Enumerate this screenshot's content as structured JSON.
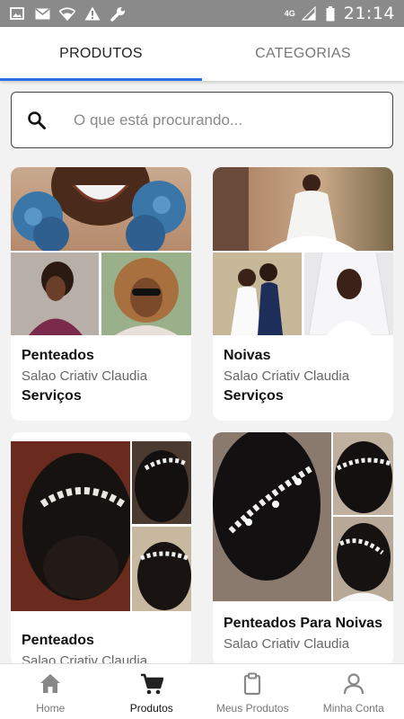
{
  "status_bar": {
    "time": "21:14",
    "network": "4G",
    "left_icons": [
      "image-icon",
      "mail-icon",
      "wifi-icon",
      "warning-icon",
      "wrench-icon"
    ],
    "right_icons": [
      "signal-icon",
      "battery-icon"
    ]
  },
  "tabs": [
    {
      "label": "PRODUTOS",
      "active": true
    },
    {
      "label": "CATEGORIAS",
      "active": false
    }
  ],
  "search": {
    "placeholder": "O que está procurando...",
    "value": ""
  },
  "products": [
    {
      "title": "Penteados",
      "seller": "Salao Criativ Claudia",
      "category": "Serviços"
    },
    {
      "title": "Noivas",
      "seller": "Salao Criativ Claudia",
      "category": "Serviços"
    },
    {
      "title": "Penteados",
      "seller": "Salao Criativ Claudia",
      "category": ""
    },
    {
      "title": "Penteados Para Noivas",
      "seller": "Salao Criativ Claudia",
      "category": ""
    }
  ],
  "bottom_nav": [
    {
      "label": "Home",
      "icon": "home-icon",
      "active": false
    },
    {
      "label": "Produtos",
      "icon": "cart-icon",
      "active": true
    },
    {
      "label": "Meus Produtos",
      "icon": "clipboard-icon",
      "active": false
    },
    {
      "label": "Minha Conta",
      "icon": "user-icon",
      "active": false
    }
  ],
  "colors": {
    "accent": "#2b6fe3",
    "status_bar": "#8a8a8a",
    "background": "#f2f2f2"
  }
}
